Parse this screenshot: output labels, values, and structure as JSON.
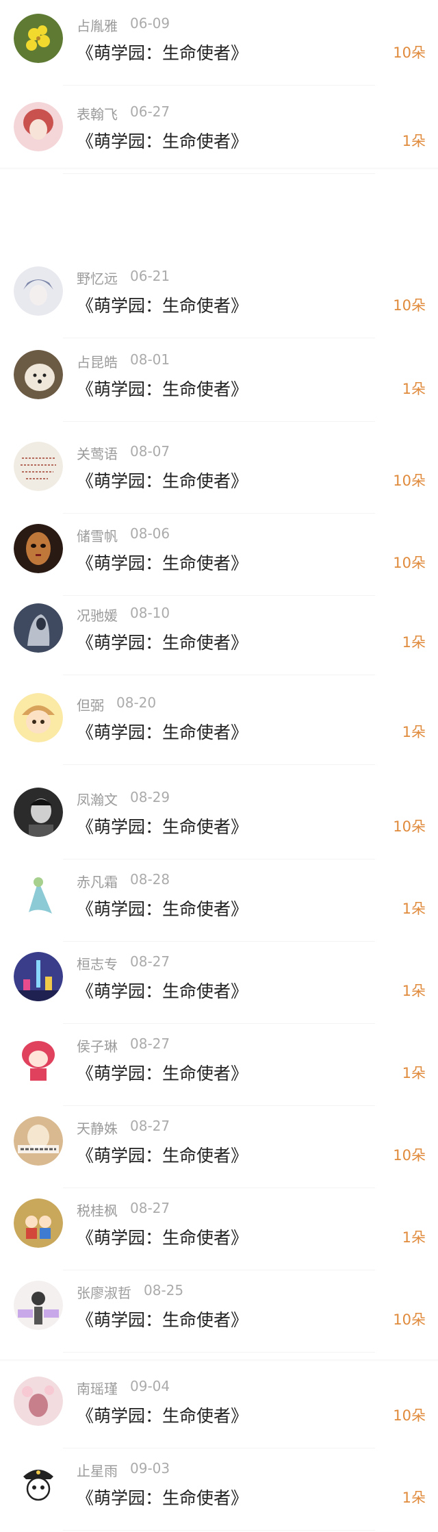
{
  "gifts": [
    {
      "user": "占胤雅",
      "date": "06-09",
      "title": "《萌学园：生命使者》",
      "count": "10朵",
      "avatar": "yellow-flower-avatar",
      "bg": "#5f7a33",
      "fg": "#f2d92e"
    },
    {
      "user": "表翰飞",
      "date": "06-27",
      "title": "《萌学园：生命使者》",
      "count": "1朵",
      "avatar": "pink-hair-girl-avatar",
      "bg": "#f4d5d8",
      "fg": "#c9524f"
    },
    {
      "user": "野忆远",
      "date": "06-21",
      "title": "《萌学园：生命使者》",
      "count": "10朵",
      "avatar": "anime-boy-sketch-avatar",
      "bg": "#e8e8ef",
      "fg": "#7c86a8"
    },
    {
      "user": "占昆皓",
      "date": "08-01",
      "title": "《萌学园：生命使者》",
      "count": "1朵",
      "avatar": "white-dog-avatar",
      "bg": "#6b5a44",
      "fg": "#efe7d9"
    },
    {
      "user": "关莺语",
      "date": "08-07",
      "title": "《萌学园：生命使者》",
      "count": "10朵",
      "avatar": "handwritten-text-avatar",
      "bg": "#f1ece3",
      "fg": "#b56b5c"
    },
    {
      "user": "储雪帆",
      "date": "08-06",
      "title": "《萌学园：生命使者》",
      "count": "10朵",
      "avatar": "masked-face-avatar",
      "bg": "#2a1a14",
      "fg": "#c0783a"
    },
    {
      "user": "况驰媛",
      "date": "08-10",
      "title": "《萌学园：生命使者》",
      "count": "1朵",
      "avatar": "grey-cloaked-figure-avatar",
      "bg": "#3f4a60",
      "fg": "#b9c0cc"
    },
    {
      "user": "但弼",
      "date": "08-20",
      "title": "《萌学园：生命使者》",
      "count": "1朵",
      "avatar": "cartoon-boy-avatar",
      "bg": "#fbe9a6",
      "fg": "#d9a25a"
    },
    {
      "user": "凤瀚文",
      "date": "08-29",
      "title": "《萌学园：生命使者》",
      "count": "10朵",
      "avatar": "monochrome-man-avatar",
      "bg": "#2b2b2b",
      "fg": "#cfcfcf"
    },
    {
      "user": "赤凡霜",
      "date": "08-28",
      "title": "《萌学园：生命使者》",
      "count": "1朵",
      "avatar": "fairy-figure-avatar",
      "bg": "#ffffff",
      "fg": "#8ccbd6"
    },
    {
      "user": "桓志专",
      "date": "08-27",
      "title": "《萌学园：生命使者》",
      "count": "1朵",
      "avatar": "city-night-skyline-avatar",
      "bg": "#3a3d8a",
      "fg": "#e84c8c"
    },
    {
      "user": "侯子琳",
      "date": "08-27",
      "title": "《萌学园：生命使者》",
      "count": "1朵",
      "avatar": "pink-cartoon-girl-avatar",
      "bg": "#ffffff",
      "fg": "#e0425e"
    },
    {
      "user": "天静姝",
      "date": "08-27",
      "title": "《萌学园：生命使者》",
      "count": "10朵",
      "avatar": "girl-with-caption-avatar",
      "bg": "#d9b98f",
      "fg": "#f5e6cf"
    },
    {
      "user": "税桂枫",
      "date": "08-27",
      "title": "《萌学园：生命使者》",
      "count": "1朵",
      "avatar": "cartoon-kids-avatar",
      "bg": "#c9a85c",
      "fg": "#d2473a"
    },
    {
      "user": "张廖淑哲",
      "date": "08-25",
      "title": "《萌学园：生命使者》",
      "count": "10朵",
      "avatar": "girl-with-signs-avatar",
      "bg": "#f4f0ef",
      "fg": "#3a3a3a"
    },
    {
      "user": "南瑶瑾",
      "date": "09-04",
      "title": "《萌学园：生命使者》",
      "count": "10朵",
      "avatar": "blossom-girl-avatar",
      "bg": "#f2dcdf",
      "fg": "#c77f8c"
    },
    {
      "user": "止星雨",
      "date": "09-03",
      "title": "《萌学园：生命使者》",
      "count": "1朵",
      "avatar": "police-cartoon-avatar",
      "bg": "#ffffff",
      "fg": "#222222"
    }
  ]
}
